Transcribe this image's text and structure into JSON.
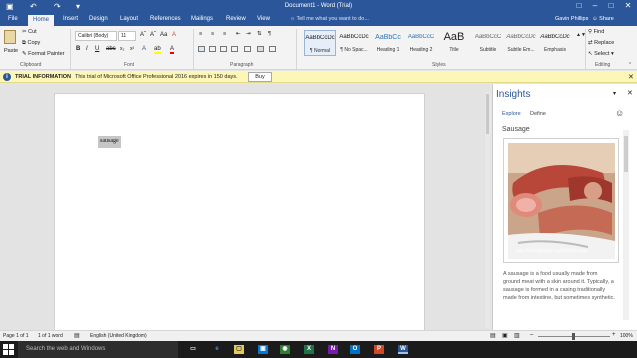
{
  "window": {
    "title": "Document1 - Word (Trial)",
    "user": "Gavin Phillips",
    "share_label": "Share"
  },
  "tabs": [
    "File",
    "Home",
    "Insert",
    "Design",
    "Layout",
    "References",
    "Mailings",
    "Review",
    "View"
  ],
  "tellme": "Tell me what you want to do...",
  "clipboard": {
    "paste": "Paste",
    "cut": "Cut",
    "copy": "Copy",
    "format_painter": "Format Painter",
    "group_label": "Clipboard"
  },
  "font": {
    "name": "Calibri (Body)",
    "size": "11",
    "group_label": "Font"
  },
  "paragraph": {
    "group_label": "Paragraph"
  },
  "styles": {
    "group_label": "Styles",
    "items": [
      {
        "sample": "AaBbCcDc",
        "name": "¶ Normal"
      },
      {
        "sample": "AaBbCcDc",
        "name": "¶ No Spac..."
      },
      {
        "sample": "AaBbCc",
        "name": "Heading 1"
      },
      {
        "sample": "AaBbCcC",
        "name": "Heading 2"
      },
      {
        "sample": "AaB",
        "name": "Title"
      },
      {
        "sample": "AaBbCcC",
        "name": "Subtitle"
      },
      {
        "sample": "AaBbCcDc",
        "name": "Subtle Em..."
      },
      {
        "sample": "AaBbCcDc",
        "name": "Emphasis"
      }
    ]
  },
  "editing": {
    "find": "Find",
    "replace": "Replace",
    "select": "Select",
    "group_label": "Editing"
  },
  "infobar": {
    "label": "TRIAL INFORMATION",
    "message": "This trial of Microsoft Office Professional 2016 expires in 150 days.",
    "button": "Buy"
  },
  "document": {
    "selected_text": "sausage"
  },
  "insights": {
    "title": "Insights",
    "tab_explore": "Explore",
    "tab_define": "Define",
    "topic": "Sausage",
    "image_caption": "http://en.wikipedia.org/wiki/Sausage",
    "description": "A sausage is a food usually made from ground meat with a skin around it. Typically, a sausage is formed in a casing traditionally made from intestine, but sometimes synthetic."
  },
  "status": {
    "page": "Page 1 of 1",
    "words": "1 of 1 word",
    "language": "English (United Kingdom)",
    "zoom": "100%"
  },
  "taskbar": {
    "search": "Search the web and Windows"
  },
  "colors": {
    "word_blue": "#2b579a",
    "infobar": "#fcf7b6",
    "taskbar": "#1b1b1b"
  }
}
